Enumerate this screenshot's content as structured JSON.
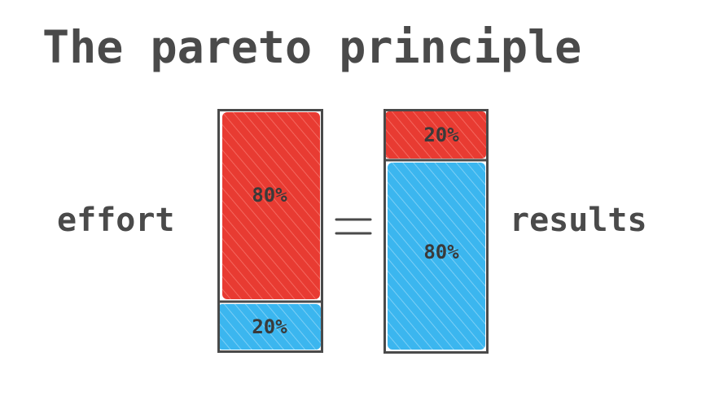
{
  "title": "The pareto principle",
  "left_label": "effort",
  "right_label": "results",
  "equals_sign": "=",
  "colors": {
    "red": "#e83b32",
    "blue": "#3bb6ef",
    "ink": "#4a4a4a"
  },
  "bars": [
    {
      "name": "effort",
      "segments": [
        {
          "label": "80%",
          "share": 0.8,
          "color": "red"
        },
        {
          "label": "20%",
          "share": 0.2,
          "color": "blue"
        }
      ]
    },
    {
      "name": "results",
      "segments": [
        {
          "label": "20%",
          "share": 0.2,
          "color": "red"
        },
        {
          "label": "80%",
          "share": 0.8,
          "color": "blue"
        }
      ]
    }
  ]
}
